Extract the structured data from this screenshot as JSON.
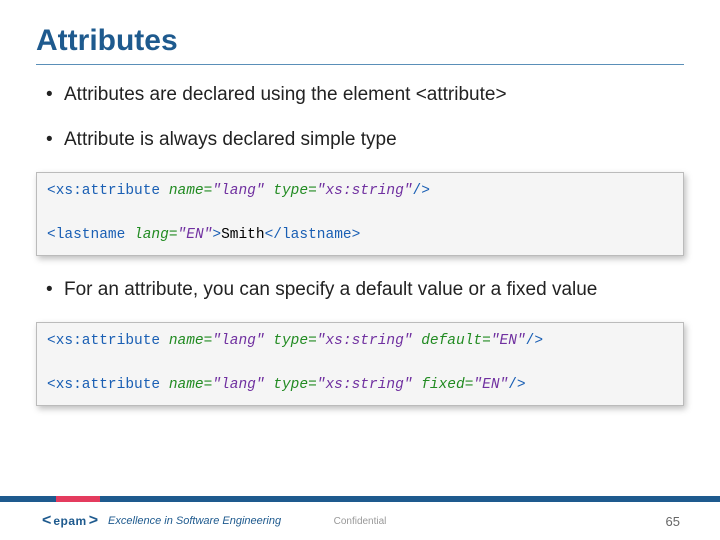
{
  "title": "Attributes",
  "bullets": {
    "b1": "Attributes are declared using the element <attribute>",
    "b2": "Attribute is always declared simple type",
    "b3": "For an attribute, you can specify a default value or a fixed value"
  },
  "code1": {
    "l1_tag": "<xs:attribute",
    "l1_attr": " name=",
    "l1_val1": "\"lang\"",
    "l1_attr2": " type=",
    "l1_val2": "\"xs:string\"",
    "l1_close": "/>",
    "l2_open": "<lastname",
    "l2_attr": " lang=",
    "l2_val": "\"EN\"",
    "l2_gt": ">",
    "l2_text": "Smith",
    "l2_close": "</lastname>"
  },
  "code2": {
    "l1_tag": "<xs:attribute",
    "l1_name": " name=",
    "l1_nameval": "\"lang\"",
    "l1_type": " type=",
    "l1_typeval": "\"xs:string\"",
    "l1_def": " default=",
    "l1_defval": "\"EN\"",
    "l1_close": "/>",
    "l2_tag": "<xs:attribute",
    "l2_name": " name=",
    "l2_nameval": "\"lang\"",
    "l2_type": " type=",
    "l2_typeval": "\"xs:string\"",
    "l2_fix": " fixed=",
    "l2_fixval": "\"EN\"",
    "l2_close": "/>"
  },
  "footer": {
    "logo": "epam",
    "tagline": "Excellence in Software Engineering",
    "confidential": "Confidential",
    "page": "65"
  }
}
